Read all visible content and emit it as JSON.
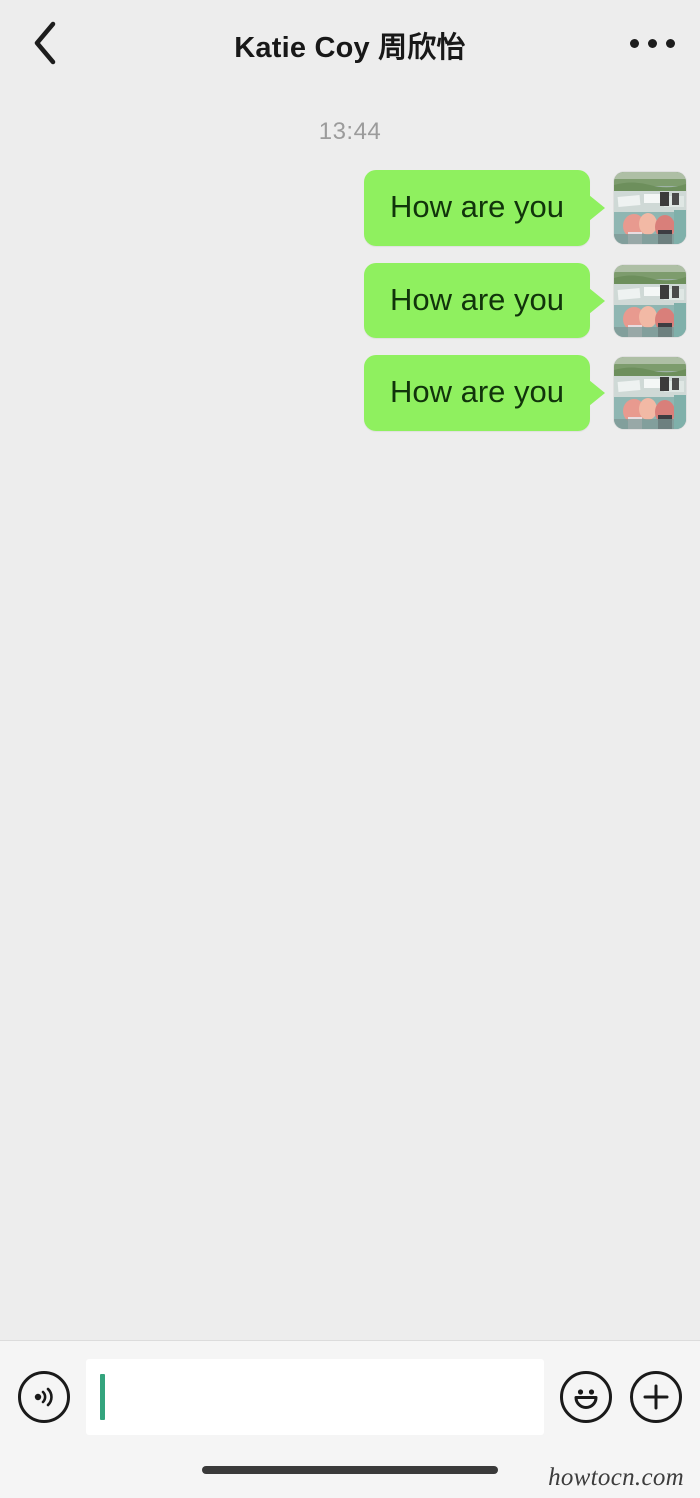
{
  "header": {
    "title": "Katie Coy 周欣怡",
    "back_icon": "chevron-left-icon",
    "more_icon": "ellipsis-horizontal-icon"
  },
  "chat": {
    "timestamp": "13:44",
    "messages": [
      {
        "text": "How are you",
        "side": "outgoing",
        "avatar": "user-photo-avatar"
      },
      {
        "text": "How are you",
        "side": "outgoing",
        "avatar": "user-photo-avatar"
      },
      {
        "text": "How are you",
        "side": "outgoing",
        "avatar": "user-photo-avatar"
      }
    ]
  },
  "input_bar": {
    "voice_icon": "voice-wave-icon",
    "emoji_icon": "smiley-face-icon",
    "add_icon": "plus-circle-icon",
    "field_value": "",
    "field_placeholder": ""
  },
  "footer": {
    "watermark": "howtocn.com"
  },
  "colors": {
    "bubble_green": "#8ff05f",
    "bubble_text": "#11340b",
    "background": "#ededed",
    "input_background": "#f5f5f5",
    "caret_green": "#34a47d",
    "timestamp_gray": "#9b9b9b"
  }
}
